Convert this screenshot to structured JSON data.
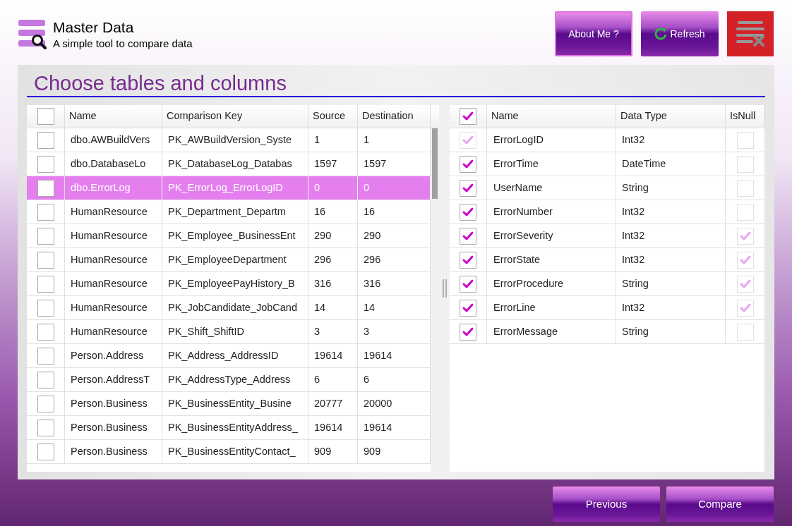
{
  "app": {
    "title": "Master Data",
    "subtitle": "A simple tool to compare data"
  },
  "header_buttons": [
    {
      "label": "About Me ?",
      "kind": "plain"
    },
    {
      "label": "Refresh",
      "kind": "refresh"
    }
  ],
  "panel_title": "Choose tables and columns",
  "tables": {
    "all_checked": false,
    "columns": [
      "Name",
      "Comparison Key",
      "Source",
      "Destination"
    ],
    "rows": [
      {
        "checked": false,
        "selected": false,
        "name": "dbo.AWBuildVers",
        "key": "PK_AWBuildVersion_Syste",
        "source": "1",
        "destination": "1"
      },
      {
        "checked": false,
        "selected": false,
        "name": "dbo.DatabaseLo",
        "key": "PK_DatabaseLog_Databas",
        "source": "1597",
        "destination": "1597"
      },
      {
        "checked": false,
        "selected": true,
        "name": "dbo.ErrorLog",
        "key": "PK_ErrorLog_ErrorLogID",
        "source": "0",
        "destination": "0"
      },
      {
        "checked": false,
        "selected": false,
        "name": "HumanResource",
        "key": "PK_Department_Departm",
        "source": "16",
        "destination": "16"
      },
      {
        "checked": false,
        "selected": false,
        "name": "HumanResource",
        "key": "PK_Employee_BusinessEnt",
        "source": "290",
        "destination": "290"
      },
      {
        "checked": false,
        "selected": false,
        "name": "HumanResource",
        "key": "PK_EmployeeDepartment",
        "source": "296",
        "destination": "296"
      },
      {
        "checked": false,
        "selected": false,
        "name": "HumanResource",
        "key": "PK_EmployeePayHistory_B",
        "source": "316",
        "destination": "316"
      },
      {
        "checked": false,
        "selected": false,
        "name": "HumanResource",
        "key": "PK_JobCandidate_JobCand",
        "source": "14",
        "destination": "14"
      },
      {
        "checked": false,
        "selected": false,
        "name": "HumanResource",
        "key": "PK_Shift_ShiftID",
        "source": "3",
        "destination": "3"
      },
      {
        "checked": false,
        "selected": false,
        "name": "Person.Address",
        "key": "PK_Address_AddressID",
        "source": "19614",
        "destination": "19614"
      },
      {
        "checked": false,
        "selected": false,
        "name": "Person.AddressT",
        "key": "PK_AddressType_Address",
        "source": "6",
        "destination": "6"
      },
      {
        "checked": false,
        "selected": false,
        "name": "Person.Business",
        "key": "PK_BusinessEntity_Busine",
        "source": "20777",
        "destination": "20000"
      },
      {
        "checked": false,
        "selected": false,
        "name": "Person.Business",
        "key": "PK_BusinessEntityAddress_",
        "source": "19614",
        "destination": "19614"
      },
      {
        "checked": false,
        "selected": false,
        "name": "Person.Business",
        "key": "PK_BusinessEntityContact_",
        "source": "909",
        "destination": "909"
      }
    ]
  },
  "columns_grid": {
    "all_checked": true,
    "columns": [
      "Name",
      "Data Type",
      "IsNull"
    ],
    "rows": [
      {
        "include_checked": true,
        "include_disabled": true,
        "name": "ErrorLogID",
        "data_type": "Int32",
        "isnull_checked": false,
        "isnull_disabled": true
      },
      {
        "include_checked": true,
        "include_disabled": false,
        "name": "ErrorTime",
        "data_type": "DateTime",
        "isnull_checked": false,
        "isnull_disabled": true
      },
      {
        "include_checked": true,
        "include_disabled": false,
        "name": "UserName",
        "data_type": "String",
        "isnull_checked": false,
        "isnull_disabled": true
      },
      {
        "include_checked": true,
        "include_disabled": false,
        "name": "ErrorNumber",
        "data_type": "Int32",
        "isnull_checked": false,
        "isnull_disabled": true
      },
      {
        "include_checked": true,
        "include_disabled": false,
        "name": "ErrorSeverity",
        "data_type": "Int32",
        "isnull_checked": true,
        "isnull_disabled": true
      },
      {
        "include_checked": true,
        "include_disabled": false,
        "name": "ErrorState",
        "data_type": "Int32",
        "isnull_checked": true,
        "isnull_disabled": true
      },
      {
        "include_checked": true,
        "include_disabled": false,
        "name": "ErrorProcedure",
        "data_type": "String",
        "isnull_checked": true,
        "isnull_disabled": true
      },
      {
        "include_checked": true,
        "include_disabled": false,
        "name": "ErrorLine",
        "data_type": "Int32",
        "isnull_checked": true,
        "isnull_disabled": true
      },
      {
        "include_checked": true,
        "include_disabled": false,
        "name": "ErrorMessage",
        "data_type": "String",
        "isnull_checked": false,
        "isnull_disabled": true
      }
    ]
  },
  "footer_buttons": [
    "Previous",
    "Compare"
  ]
}
